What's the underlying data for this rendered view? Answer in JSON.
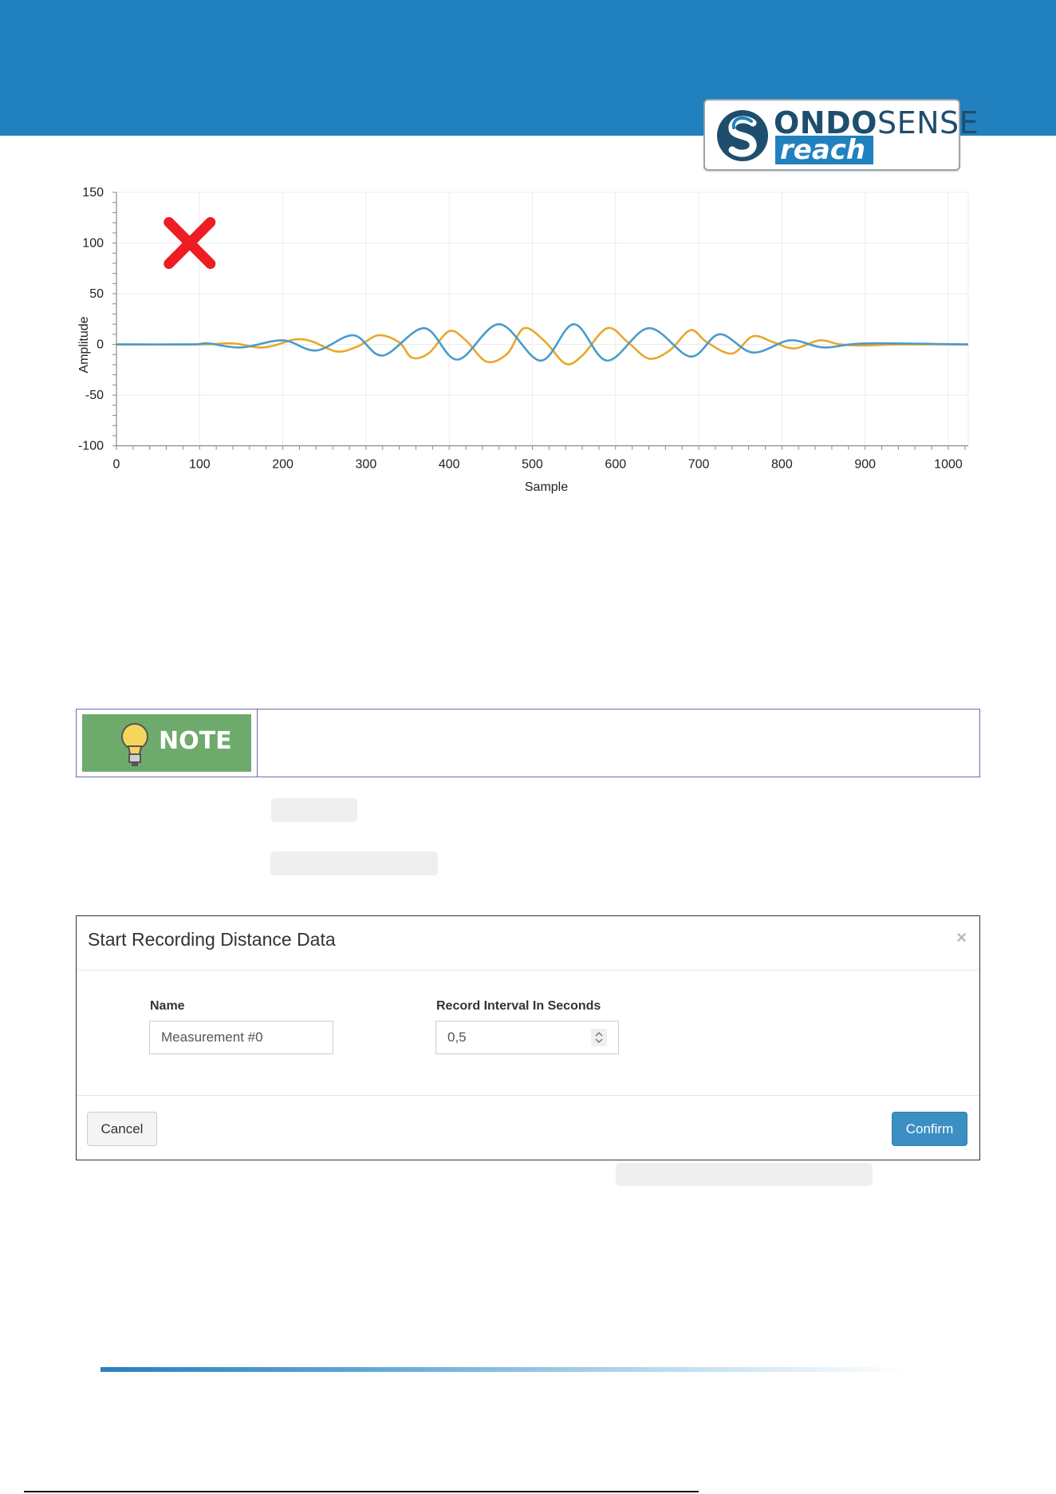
{
  "header": {
    "brand_bold": "ONDO",
    "brand_regular": "SENSE",
    "brand_sub": "reach",
    "band_color": "#2181be"
  },
  "chart_data": {
    "type": "line",
    "xlabel": "Sample",
    "ylabel": "Amplitude",
    "xlim": [
      0,
      1024
    ],
    "ylim": [
      -100,
      150
    ],
    "x_ticks": [
      0,
      100,
      200,
      300,
      400,
      500,
      600,
      700,
      800,
      900,
      1000
    ],
    "y_ticks": [
      150,
      100,
      50,
      0,
      -50,
      -100
    ],
    "grid": true,
    "marker_icon": "red-x-icon",
    "series": [
      {
        "color": "#e8a72c",
        "x": [
          0,
          100,
          140,
          170,
          190,
          215,
          235,
          265,
          290,
          315,
          340,
          355,
          375,
          400,
          420,
          445,
          470,
          490,
          515,
          540,
          560,
          590,
          615,
          640,
          665,
          690,
          710,
          740,
          765,
          790,
          815,
          845,
          870,
          900,
          940,
          1024
        ],
        "y": [
          0,
          0,
          1,
          -3,
          -1,
          5,
          3,
          -7,
          -2,
          9,
          2,
          -13,
          -9,
          13,
          4,
          -17,
          -9,
          16,
          3,
          -19,
          -11,
          16,
          2,
          -14,
          -6,
          14,
          2,
          -9,
          8,
          2,
          -4,
          4,
          0,
          -1,
          0,
          0
        ]
      },
      {
        "color": "#4a9cc9",
        "x": [
          0,
          90,
          110,
          150,
          200,
          240,
          285,
          320,
          370,
          410,
          460,
          510,
          550,
          590,
          640,
          690,
          725,
          765,
          810,
          850,
          900,
          1024
        ],
        "y": [
          0,
          0,
          1,
          -3,
          4,
          -6,
          9,
          -11,
          16,
          -15,
          20,
          -16,
          20,
          -16,
          16,
          -12,
          10,
          -8,
          4,
          -3,
          1,
          0
        ]
      }
    ]
  },
  "note": {
    "label": "NOTE",
    "badge_color": "#6faa6d"
  },
  "modal": {
    "title": "Start Recording Distance Data",
    "close_glyph": "×",
    "name_label": "Name",
    "name_value": "Measurement #0",
    "interval_label": "Record Interval In Seconds",
    "interval_value": "0,5",
    "cancel_label": "Cancel",
    "confirm_label": "Confirm"
  }
}
